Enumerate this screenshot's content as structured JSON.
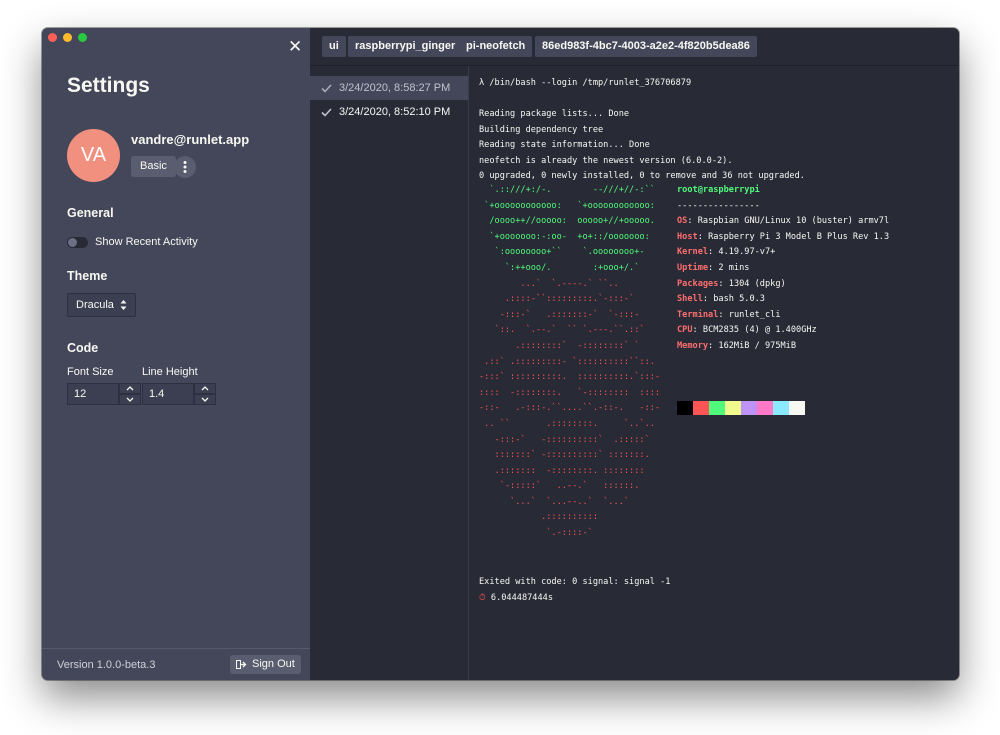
{
  "settings": {
    "title": "Settings",
    "avatar_initials": "VA",
    "email": "vandre@runlet.app",
    "plan": "Basic",
    "general": {
      "heading": "General",
      "show_recent_activity": "Show Recent Activity",
      "show_recent_activity_on": false
    },
    "theme": {
      "heading": "Theme",
      "selected": "Dracula"
    },
    "code": {
      "heading": "Code",
      "font_size_label": "Font Size",
      "font_size": "12",
      "line_height_label": "Line Height",
      "line_height": "1.4"
    },
    "version": "Version 1.0.0-beta.3",
    "sign_out": "Sign Out"
  },
  "breadcrumb": [
    "ui",
    "raspberrypi_ginger",
    "pi-neofetch",
    "86ed983f-4bc7-4003-a2e2-4f820b5dea86"
  ],
  "runs": [
    {
      "time": "3/24/2020, 8:58:27 PM",
      "active": true
    },
    {
      "time": "3/24/2020, 8:52:10 PM",
      "active": false
    }
  ],
  "terminal": {
    "command": "λ /bin/bash --login /tmp/runlet_376706879",
    "output": [
      "Reading package lists... Done",
      "Building dependency tree",
      "Reading state information... Done",
      "neofetch is already the newest version (6.0.0-2).",
      "0 upgraded, 0 newly installed, 0 to remove and 36 not upgraded."
    ],
    "logo_green": [
      "  `.::///+:/-.        --///+//-:``",
      " `+oooooooooooo:   `+oooooooooooo:",
      "  /oooo++//ooooo:  ooooo+//+ooooo.",
      "  `+ooooooo:-:oo-  +o+::/ooooooo:",
      "   `:oooooooo+``    `.oooooooo+-",
      "     `:++ooo/.        :+ooo+/.`"
    ],
    "logo_red": [
      "        ...`  `.----.` ``..",
      "     .::::-``:::::::::.`-:::-`",
      "    -:::-`   .:::::::-`  `-:::-",
      "   `::.  `.--.`  `` `.---.``.::`",
      "       .::::::::`  -::::::::` `",
      " .::` .:::::::::- `::::::::::``::.",
      "-:::` ::::::::::.  ::::::::::.`:::-",
      "::::  -::::::::.   `-::::::::  ::::",
      "-::-   .-:::-.``....``.-::-.   -::-",
      " .. ``       .::::::::.     `..`..",
      "   -:::-`   -::::::::::`  .:::::`",
      "   :::::::` -::::::::::` :::::::.",
      "   .:::::::  -::::::::. ::::::::",
      "    `-:::::`   ..--.`   ::::::.",
      "      `...`  `...--..`  `...`",
      "            .::::::::::",
      "             `.-::::-`"
    ],
    "sysinfo": {
      "user": "root",
      "host": "raspberrypi",
      "separator": "----------------",
      "rows": [
        {
          "key": "OS",
          "value": "Raspbian GNU/Linux 10 (buster) armv7l"
        },
        {
          "key": "Host",
          "value": "Raspberry Pi 3 Model B Plus Rev 1.3"
        },
        {
          "key": "Kernel",
          "value": "4.19.97-v7+"
        },
        {
          "key": "Uptime",
          "value": "2 mins"
        },
        {
          "key": "Packages",
          "value": "1304 (dpkg)"
        },
        {
          "key": "Shell",
          "value": "bash 5.0.3"
        },
        {
          "key": "Terminal",
          "value": "runlet_cli"
        },
        {
          "key": "CPU",
          "value": "BCM2835 (4) @ 1.400GHz"
        },
        {
          "key": "Memory",
          "value": "162MiB / 975MiB"
        }
      ]
    },
    "palette": [
      "#000000",
      "#ff5555",
      "#50fa7b",
      "#f1fa8c",
      "#bd93f9",
      "#ff79c6",
      "#8be9fd",
      "#f8f8f2"
    ],
    "exit": "Exited with code: 0 signal: signal -1",
    "duration": "6.044487444s"
  }
}
